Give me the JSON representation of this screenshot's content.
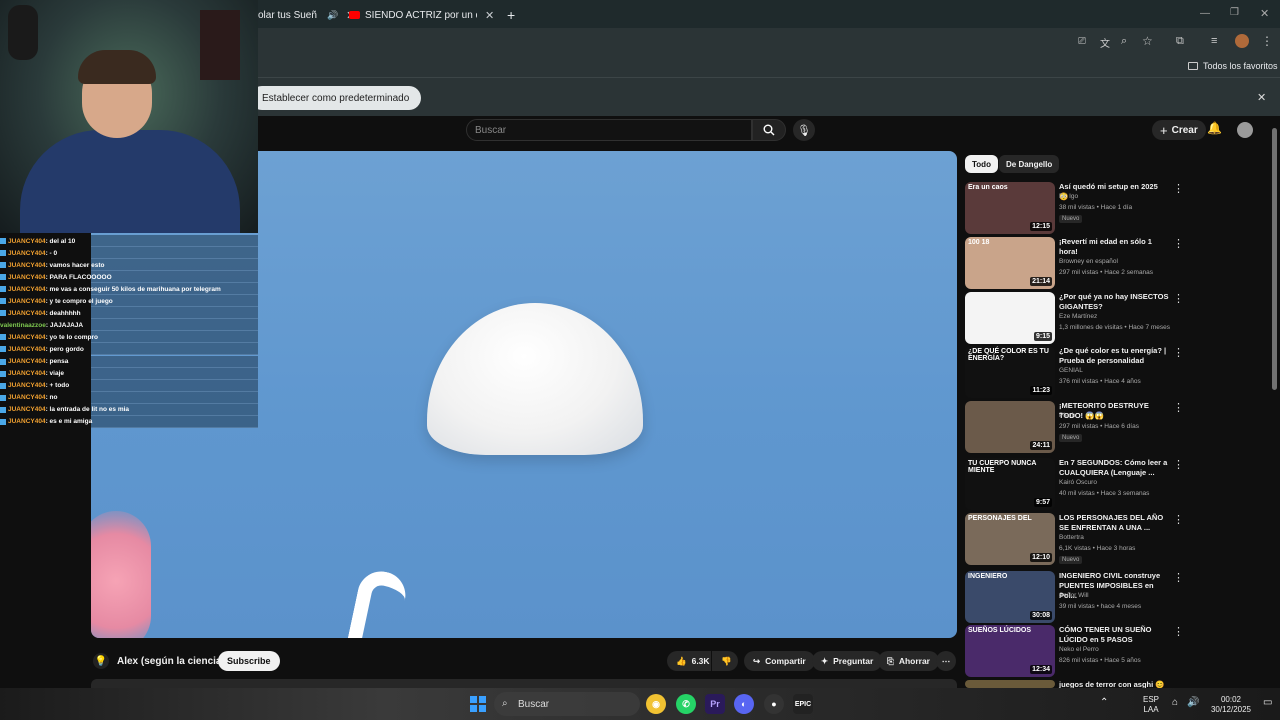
{
  "browser": {
    "tabs": [
      {
        "label": "olar tus Sueñ",
        "active": true
      },
      {
        "label": "SIENDO ACTRIZ por un día para",
        "active": false
      }
    ],
    "new_tab": "+",
    "bookmarks_label": "Todos los favoritos",
    "infobar_button": "Establecer como predeterminado"
  },
  "youtube": {
    "search_placeholder": "Buscar",
    "create_label": "Crear",
    "channel_name": "Alex (según la ciencia)",
    "subscribe_label": "Subscribe",
    "likes": "6.3K",
    "share_label": "Compartir",
    "ask_label": "Preguntar",
    "save_label": "Ahorrar",
    "chips": [
      "Todo",
      "De Dangello"
    ]
  },
  "chat": [
    {
      "user": "JUANCY404",
      "msg": ": del al 10",
      "color": "orange"
    },
    {
      "user": "JUANCY404",
      "msg": ": - 0",
      "color": "orange"
    },
    {
      "user": "JUANCY404",
      "msg": ": vamos hacer esto",
      "color": "orange"
    },
    {
      "user": "JUANCY404",
      "msg": ": PARA FLACOOOOO",
      "color": "orange"
    },
    {
      "user": "JUANCY404",
      "msg": ": me vas a conseguir 50 kilos de marihuana por telegram",
      "color": "orange"
    },
    {
      "user": "JUANCY404",
      "msg": ": y te compro el juego",
      "color": "orange"
    },
    {
      "user": "JUANCY404",
      "msg": ": deahhhhh",
      "color": "orange"
    },
    {
      "user": "valentinaazzoe",
      "msg": ": JAJAJAJA",
      "color": "green"
    },
    {
      "user": "JUANCY404",
      "msg": ": yo te lo compro",
      "color": "orange"
    },
    {
      "user": "JUANCY404",
      "msg": ": pero gordo",
      "color": "orange"
    },
    {
      "user": "JUANCY404",
      "msg": ": pensa",
      "color": "orange"
    },
    {
      "user": "JUANCY404",
      "msg": ": viaje",
      "color": "orange"
    },
    {
      "user": "JUANCY404",
      "msg": ": + todo",
      "color": "orange"
    },
    {
      "user": "JUANCY404",
      "msg": ": no",
      "color": "orange"
    },
    {
      "user": "JUANCY404",
      "msg": ": la entrada de lit no es mia",
      "color": "orange"
    },
    {
      "user": "JUANCY404",
      "msg": ": es e mi amiga",
      "color": "orange"
    }
  ],
  "recommendations": [
    {
      "title": "Así quedó mi setup en 2025 😳",
      "channel": "Dr. Igo",
      "meta": "38 mil vistas • Hace 1 día",
      "duration": "12:15",
      "badge": "Nuevo",
      "thumb_text": "Era un caos",
      "thumb_color": "#5a3a3a"
    },
    {
      "title": "¡Revertí mi edad en sólo 1 hora!",
      "channel": "Browney en español",
      "meta": "297 mil vistas • Hace 2 semanas",
      "duration": "21:14",
      "badge": "",
      "thumb_text": "100   18",
      "thumb_color": "#c9a48a"
    },
    {
      "title": "¿Por qué ya no hay INSECTOS GIGANTES?",
      "channel": "Eze Martínez",
      "meta": "1,3 millones de visitas • Hace 7 meses",
      "duration": "9:15",
      "badge": "",
      "thumb_text": "",
      "thumb_color": "#f4f4f4"
    },
    {
      "title": "¿De qué color es tu energía? | Prueba de personalidad",
      "channel": "GENIAL",
      "meta": "376 mil vistas • Hace 4 años",
      "duration": "11:23",
      "badge": "",
      "thumb_text": "¿DE QUÉ COLOR ES TU ENERGÍA?",
      "thumb_color": "#111111"
    },
    {
      "title": "¡METEORITO DESTRUYE TODO! 😱😱",
      "channel": "Plech",
      "meta": "297 mil vistas • Hace 6 días",
      "duration": "24:11",
      "badge": "Nuevo",
      "thumb_text": "",
      "thumb_color": "#6b5a4a"
    },
    {
      "title": "En 7 SEGUNDOS: Cómo leer a CUALQUIERA (Lenguaje ...",
      "channel": "Kairó Oscuro",
      "meta": "40 mil vistas • Hace 3 semanas",
      "duration": "9:57",
      "badge": "",
      "thumb_text": "TU CUERPO NUNCA MIENTE",
      "thumb_color": "#111111"
    },
    {
      "title": "LOS PERSONAJES DEL AÑO SE ENFRENTAN A UNA ...",
      "channel": "Bottertra",
      "meta": "6,1K vistas • Hace 3 horas",
      "duration": "12:10",
      "badge": "Nuevo",
      "thumb_text": "PERSONAJES DEL",
      "thumb_color": "#7a6a5a"
    },
    {
      "title": "INGENIERO CIVIL construye PUENTES IMPOSIBLES en Pol...",
      "channel": "Señor Will",
      "meta": "39 mil vistas • hace 4 meses",
      "duration": "30:08",
      "badge": "",
      "thumb_text": "INGENIERO",
      "thumb_color": "#3a4a6a"
    },
    {
      "title": "CÓMO TENER UN SUEÑO LÚCIDO en 5 PASOS",
      "channel": "Neko el Perro",
      "meta": "826 mil vistas • Hace 5 años",
      "duration": "12:34",
      "badge": "",
      "thumb_text": "SUEÑOS LÚCIDOS",
      "thumb_color": "#4a2a6a"
    },
    {
      "title": "juegos de terror con asghi 😊",
      "channel": "",
      "meta": "",
      "duration": "",
      "badge": "",
      "thumb_text": "",
      "thumb_color": "#6a5a3a"
    }
  ],
  "taskbar": {
    "search": "Buscar",
    "lang_top": "ESP",
    "lang_bottom": "LAA",
    "time": "00:02",
    "date": "30/12/2025"
  }
}
